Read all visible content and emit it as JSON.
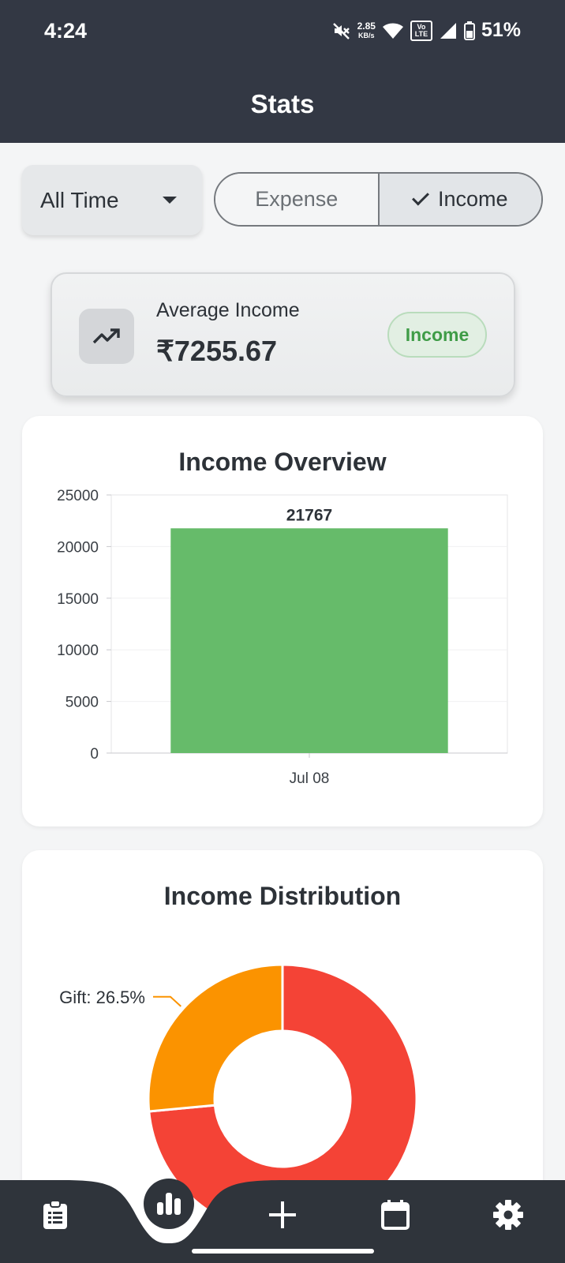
{
  "status_bar": {
    "time": "4:24",
    "net_speed": "2.85",
    "net_unit": "KB/s",
    "volte": "Vo LTE",
    "battery": "51%"
  },
  "header": {
    "title": "Stats"
  },
  "filters": {
    "period": "All Time",
    "segments": [
      {
        "label": "Expense",
        "selected": false
      },
      {
        "label": "Income",
        "selected": true
      }
    ]
  },
  "summary": {
    "label": "Average Income",
    "value": "₹7255.67",
    "badge": "Income",
    "icon": "trending-up-icon"
  },
  "overview": {
    "title": "Income Overview"
  },
  "distribution": {
    "title": "Income Distribution",
    "visible_label": "Gift: 26.5%"
  },
  "colors": {
    "header": "#333844",
    "bar": "#66bb6a",
    "slice_gift": "#fb9300",
    "slice_other": "#f44336",
    "badge_text": "#3f9c47"
  },
  "nav": [
    {
      "name": "clipboard-list-icon",
      "active": false
    },
    {
      "name": "bar-chart-icon",
      "active": true
    },
    {
      "name": "plus-icon",
      "active": false
    },
    {
      "name": "calendar-icon",
      "active": false
    },
    {
      "name": "gear-icon",
      "active": false
    }
  ],
  "chart_data": [
    {
      "type": "bar",
      "title": "Income Overview",
      "categories": [
        "Jul 08"
      ],
      "values": [
        21767
      ],
      "ylim": [
        0,
        25000
      ],
      "yticks": [
        0,
        5000,
        10000,
        15000,
        20000,
        25000
      ],
      "grid": true
    },
    {
      "type": "pie",
      "title": "Income Distribution",
      "labels": [
        "Gift",
        ""
      ],
      "values": [
        26.5,
        73.5
      ],
      "colors": [
        "#fb9300",
        "#f44336"
      ],
      "donut": true
    }
  ]
}
